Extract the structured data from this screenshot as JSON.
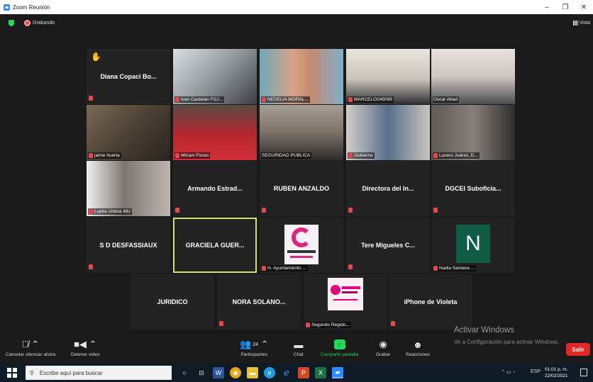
{
  "window": {
    "title": "Zoom Reunión",
    "minimize": "–",
    "restore": "❐",
    "close": "✕"
  },
  "top": {
    "recording": "Grabando",
    "view": "Vista"
  },
  "tiles": [
    {
      "id": "t1",
      "display": "Diana Copaci Bo...",
      "label": "",
      "hand": "✋"
    },
    {
      "id": "t2",
      "label": "Ivan Castelan FGJ..."
    },
    {
      "id": "t3",
      "label": "NEDELIA MORAL..."
    },
    {
      "id": "t4",
      "label": "MARCELO245099"
    },
    {
      "id": "t5",
      "label": "Oscar Abad"
    },
    {
      "id": "t6",
      "label": "jaime huerta"
    },
    {
      "id": "t7",
      "label": "Miriam Flores"
    },
    {
      "id": "t8",
      "label": "SEGURIDAD PUBLICA"
    },
    {
      "id": "t9",
      "label": "Gobierno"
    },
    {
      "id": "t10",
      "label": "Lucero Juárez, D..."
    },
    {
      "id": "t11",
      "label": "Lupita Urbina Mtz"
    },
    {
      "id": "t12",
      "display": "Armando Estrad..."
    },
    {
      "id": "t13",
      "display": "RUBEN ANZALDO"
    },
    {
      "id": "t14",
      "display": "Directora del In..."
    },
    {
      "id": "t15",
      "display": "DGCEI Suboficia..."
    },
    {
      "id": "t16",
      "display": "S D DESFASSIAUX"
    },
    {
      "id": "t17",
      "display": "GRACIELA GUER..."
    },
    {
      "id": "t18",
      "label": "H. Ayuntamiento ..."
    },
    {
      "id": "t19",
      "display": "Tere Migueles C..."
    },
    {
      "id": "t20",
      "label": "Nadia Santana ...",
      "avatar": "N"
    },
    {
      "id": "t21",
      "display": "JURIDICO"
    },
    {
      "id": "t22",
      "display": "NORA SOLANO..."
    },
    {
      "id": "t23",
      "label": "Segundo Regido..."
    },
    {
      "id": "t24",
      "display": "iPhone de Violeta"
    }
  ],
  "watermark": {
    "line1": "Activar Windows",
    "line2": "Ve a Configuración para activar Windows."
  },
  "controls": {
    "mute": "Cancelar silenciar ahora",
    "video": "Detener video",
    "participants": "Participantes",
    "participants_count": "24",
    "chat": "Chat",
    "share": "Compartir pantalla",
    "record": "Grabar",
    "reactions": "Reacciones",
    "leave": "Salir"
  },
  "taskbar": {
    "search_placeholder": "Escribe aquí para buscar",
    "lang": "ESP",
    "time": "01:01 p. m.",
    "date": "22/02/2021"
  },
  "colors": {
    "accent_green": "#23d959",
    "leave_red": "#e02828",
    "active_speaker": "#d9e06a",
    "muted_red": "#e8484a"
  }
}
